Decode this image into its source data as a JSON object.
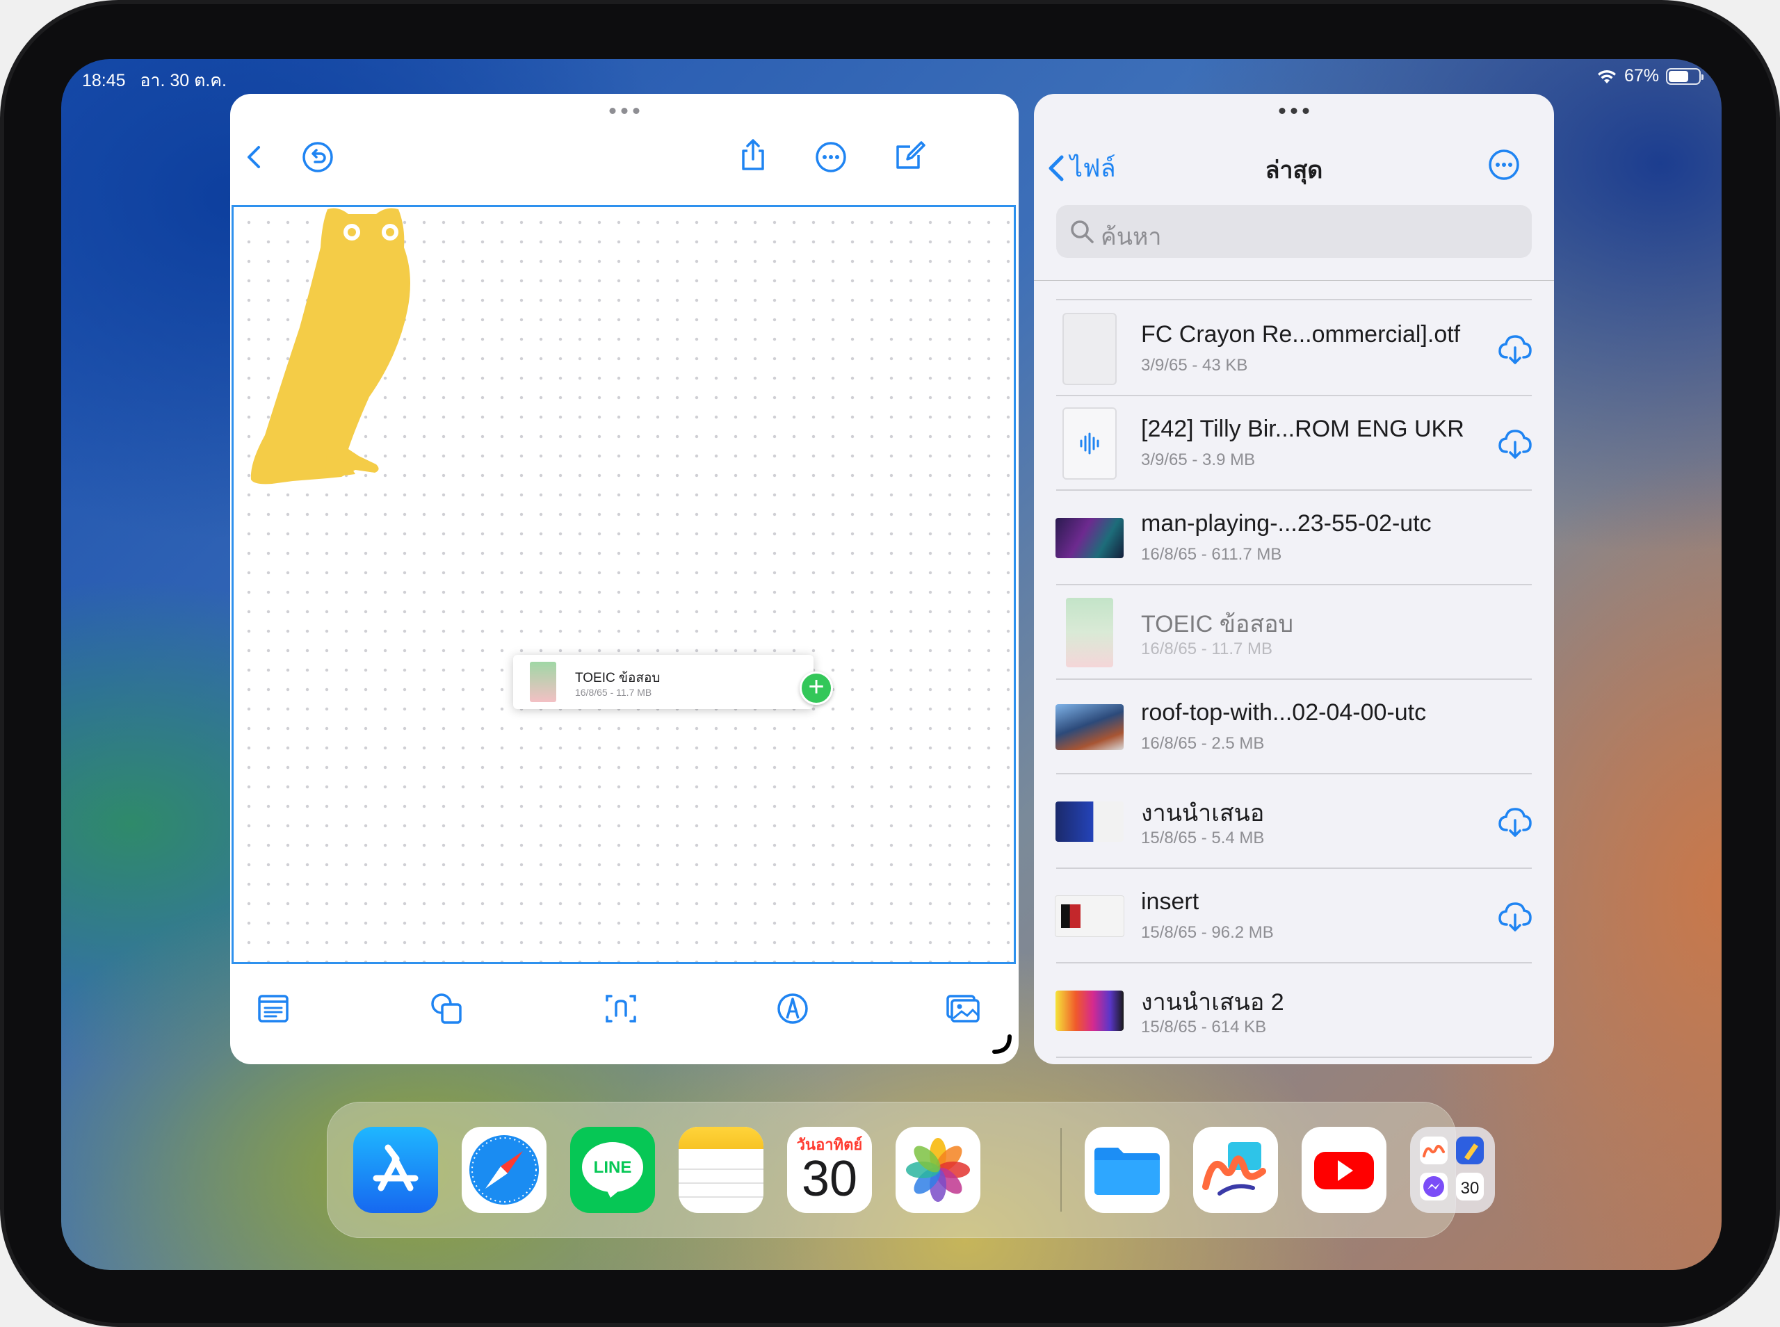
{
  "status": {
    "time": "18:45",
    "date": "อา. 30 ต.ค.",
    "battery": "67%",
    "battery_level": 0.67
  },
  "freeform": {
    "drag_preview": {
      "title": "TOEIC ข้อสอบ",
      "meta": "16/8/65 - 11.7 MB"
    }
  },
  "files": {
    "back_label": "ไฟล์",
    "title": "ล่าสุด",
    "search_placeholder": "ค้นหา",
    "items": [
      {
        "name": "FC Crayon Re...ommercial].otf",
        "meta": "3/9/65 - 43 KB",
        "cloud": true
      },
      {
        "name": "[242] Tilly Bir...ROM ENG UKR",
        "meta": "3/9/65 - 3.9 MB",
        "cloud": true
      },
      {
        "name": "man-playing-...23-55-02-utc",
        "meta": "16/8/65 - 611.7 MB",
        "cloud": false
      },
      {
        "name": "TOEIC ข้อสอบ",
        "meta": "16/8/65 - 11.7 MB",
        "cloud": false
      },
      {
        "name": "roof-top-with...02-04-00-utc",
        "meta": "16/8/65 - 2.5 MB",
        "cloud": false
      },
      {
        "name": "งานนำเสนอ",
        "meta": "15/8/65 - 5.4 MB",
        "cloud": true
      },
      {
        "name": "insert",
        "meta": "15/8/65 - 96.2 MB",
        "cloud": true
      },
      {
        "name": "งานนำเสนอ 2",
        "meta": "15/8/65 - 614 KB",
        "cloud": false
      }
    ]
  },
  "dock": {
    "calendar_day": "วันอาทิตย์",
    "calendar_date": "30",
    "line_label": "LINE",
    "folder_calendar_date": "30"
  },
  "colors": {
    "accent": "#1f84f2",
    "owl": "#f4cc47",
    "plus_badge": "#33c759"
  }
}
